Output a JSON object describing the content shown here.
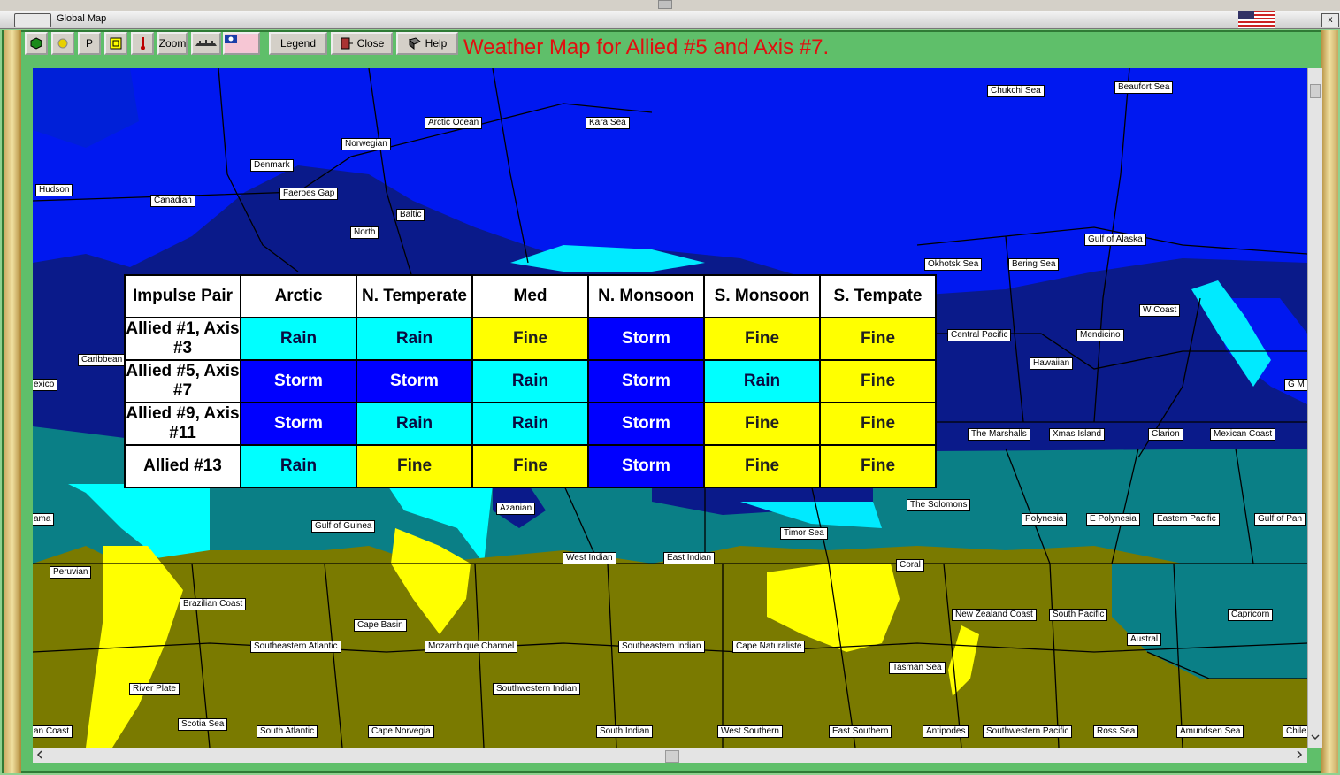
{
  "window": {
    "title": "Global Map",
    "close_glyph": "x"
  },
  "toolbar": {
    "zoom_label": "Zoom",
    "legend_label": "Legend",
    "close_label": "Close",
    "help_label": "Help",
    "p_label": "P"
  },
  "map_title": "Weather Map for Allied #5 and Axis #7.",
  "colors": {
    "storm": "#0000ff",
    "rain": "#00ffff",
    "fine": "#ffff00",
    "title": "#e01010"
  },
  "regions": [
    "Chukchi Sea",
    "Beaufort Sea",
    "Arctic Ocean",
    "Kara Sea",
    "Norwegian",
    "Denmark",
    "Hudson",
    "Canadian",
    "Faeroes Gap",
    "Baltic",
    "North",
    "Gulf of Alaska",
    "Okhotsk Sea",
    "Bering Sea",
    "W Coast",
    "Central Pacific",
    "Mendicino",
    "Hawaiian",
    "Caribbean",
    "exico",
    "G M",
    "The Marshalls",
    "Xmas Island",
    "Clarion",
    "Mexican Coast",
    "The Solomons",
    "Azanian",
    "ama",
    "Gulf of Guinea",
    "Polynesia",
    "E Polynesia",
    "Eastern Pacific",
    "Gulf of Pan",
    "Timor Sea",
    "West Indian",
    "East Indian",
    "Peruvian",
    "Coral",
    "Brazilian Coast",
    "New Zealand Coast",
    "South Pacific",
    "Capricorn",
    "Cape Basin",
    "Austral",
    "Southeastern Atlantic",
    "Mozambique Channel",
    "Southeastern Indian",
    "Cape Naturaliste",
    "Tasman Sea",
    "River Plate",
    "Southwestern Indian",
    "Scotia Sea",
    "an Coast",
    "South Atlantic",
    "Cape Norvegia",
    "South Indian",
    "West Southern",
    "East Southern",
    "Antipodes",
    "Southwestern Pacific",
    "Ross Sea",
    "Amundsen Sea",
    "Chile"
  ],
  "weather_table": {
    "headers": [
      "Impulse Pair",
      "Arctic",
      "N. Temperate",
      "Med",
      "N. Monsoon",
      "S. Monsoon",
      "S. Tempate"
    ],
    "rows": [
      {
        "pair": "Allied #1, Axis #3",
        "cells": [
          "Rain",
          "Rain",
          "Fine",
          "Storm",
          "Fine",
          "Fine"
        ]
      },
      {
        "pair": "Allied #5, Axis #7",
        "cells": [
          "Storm",
          "Storm",
          "Rain",
          "Storm",
          "Rain",
          "Fine"
        ]
      },
      {
        "pair": "Allied #9, Axis #11",
        "cells": [
          "Storm",
          "Rain",
          "Rain",
          "Storm",
          "Fine",
          "Fine"
        ]
      },
      {
        "pair": "Allied #13",
        "cells": [
          "Rain",
          "Fine",
          "Fine",
          "Storm",
          "Fine",
          "Fine"
        ]
      }
    ]
  }
}
